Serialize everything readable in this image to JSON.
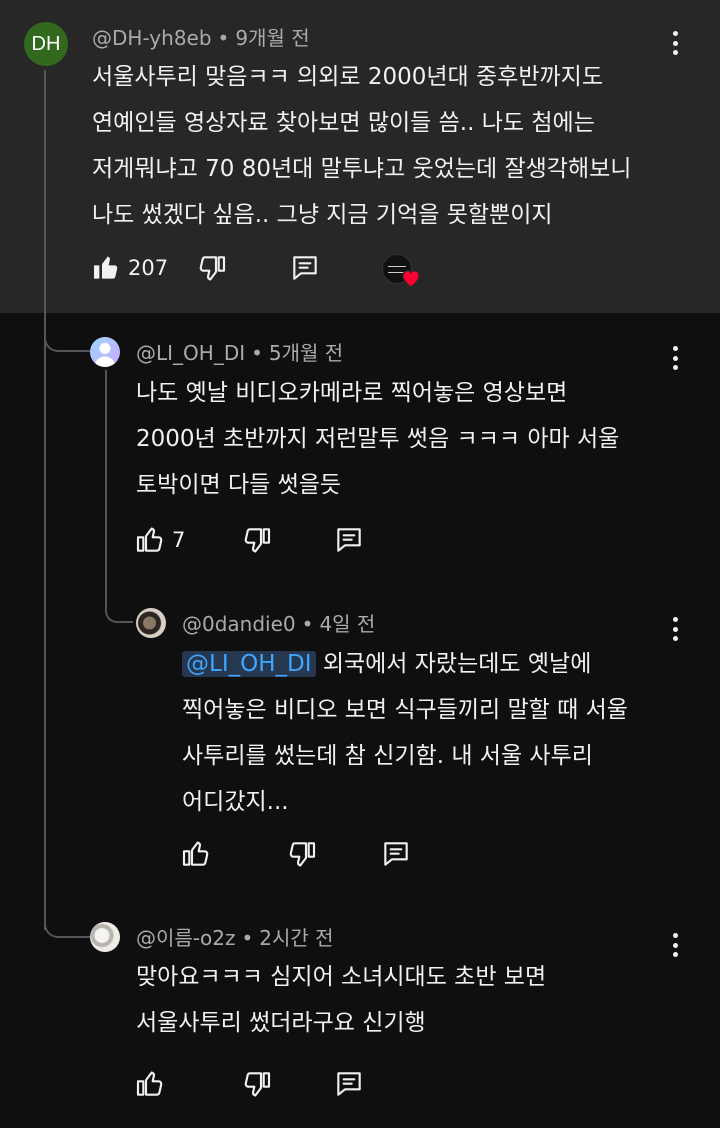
{
  "comments": [
    {
      "author": "@DH-yh8eb",
      "time": "9개월 전",
      "avatar_text": "DH",
      "avatar_color": "#33691e",
      "lines": [
        "서울사투리 맞음ㅋㅋ 의외로 2000년대 중후반까지도",
        "연예인들 영상자료 찾아보면 많이들 씀.. 나도 첨에는",
        "저게뭐냐고 70 80년대 말투냐고 웃었는데 잘생각해보니",
        "나도 썼겠다 싶음.. 그냥 지금 기억을 못할뿐이지"
      ],
      "likes": "207",
      "liked": true,
      "creator_heart": true
    },
    {
      "author": "@LI_OH_DI",
      "time": "5개월 전",
      "lines": [
        "나도 옛날 비디오카메라로 찍어놓은 영상보면",
        "2000년 초반까지 저런말투 썻음 ㅋㅋㅋ 아마 서울",
        "토박이면 다들 썻을듯"
      ],
      "likes": "7"
    },
    {
      "author": "@0dandie0",
      "time": "4일 전",
      "mention": "@LI_OH_DI",
      "lines": [
        "외국에서 자랐는데도 옛날에",
        "찍어놓은 비디오 보면 식구들끼리 말할 때 서울",
        "사투리를 썼는데 참 신기함. 내 서울 사투리",
        "어디갔지..."
      ],
      "likes": ""
    },
    {
      "author": "@이름-o2z",
      "time": "2시간 전",
      "lines": [
        "맞아요ㅋㅋㅋ 심지어 소녀시대도 초반 보면",
        "서울사투리 썼더라구요 신기행"
      ],
      "likes": ""
    }
  ],
  "separator": "•",
  "colors": {
    "highlight": "#272727",
    "background": "#0f0f0f",
    "mention": "#3ea6ff",
    "heart": "#ff0033"
  }
}
